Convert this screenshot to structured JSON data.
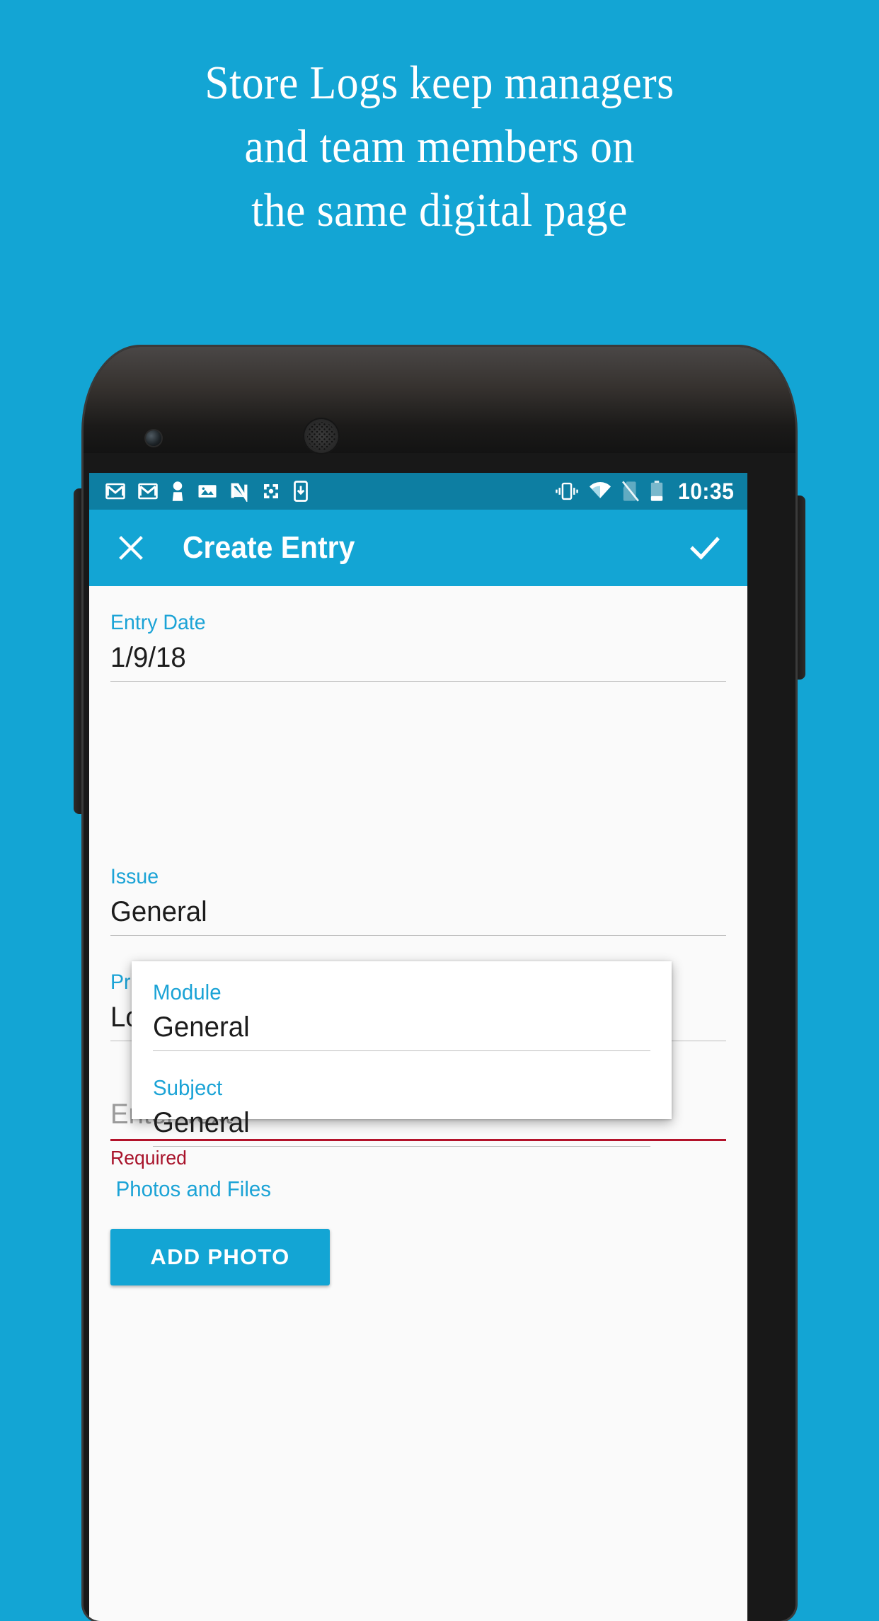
{
  "theme": {
    "background": "#13a5d4",
    "accent": "#13a5d4",
    "label_blue": "#1ba3d6",
    "error_red": "#a8122a",
    "statusbar_blue": "#0d7ea2"
  },
  "headline": {
    "line1": "Store Logs keep managers",
    "line2": "and team members on",
    "line3": "the same digital page"
  },
  "statusbar": {
    "time": "10:35",
    "left_icons": [
      "gmail-icon",
      "gmail-icon",
      "contact-icon",
      "photo-icon",
      "nimble-icon",
      "flower-icon",
      "app-download-icon"
    ],
    "right_icons": [
      "vibrate-icon",
      "wifi-icon",
      "no-sim-icon",
      "battery-icon"
    ]
  },
  "appbar": {
    "close_label": "Close",
    "title": "Create Entry",
    "confirm_label": "Save"
  },
  "form": {
    "fields": [
      {
        "label": "Entry Date",
        "value": "1/9/18"
      },
      {
        "label": "Issue",
        "value": "General"
      },
      {
        "label": "Priority",
        "value": "Low"
      }
    ],
    "text_input": {
      "placeholder": "Enter Text",
      "value": "",
      "error": "Required"
    },
    "attachments": {
      "section_label": "Photos and Files",
      "add_photo_label": "ADD PHOTO"
    }
  },
  "overlay_card": {
    "fields": [
      {
        "label": "Module",
        "value": "General"
      },
      {
        "label": "Subject",
        "value": "General"
      }
    ]
  }
}
